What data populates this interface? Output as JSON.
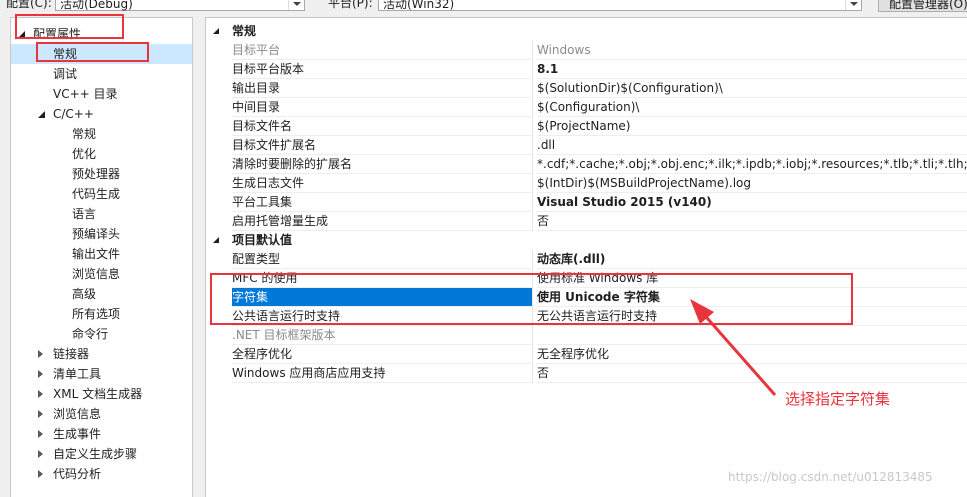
{
  "top_bar": {
    "config_label": "配置(C):",
    "config_value": "活动(Debug)",
    "platform_label": "平台(P):",
    "platform_value": "活动(Win32)",
    "config_manager_button": "配置管理器(O)..."
  },
  "tree": {
    "items": [
      {
        "label": "配置属性",
        "state": "expanded"
      },
      {
        "label": "常规",
        "state": "selected"
      },
      {
        "label": "调试"
      },
      {
        "label": "VC++ 目录"
      },
      {
        "label": "C/C++",
        "state": "expanded"
      },
      {
        "label": "常规"
      },
      {
        "label": "优化"
      },
      {
        "label": "预处理器"
      },
      {
        "label": "代码生成"
      },
      {
        "label": "语言"
      },
      {
        "label": "预编译头"
      },
      {
        "label": "输出文件"
      },
      {
        "label": "浏览信息"
      },
      {
        "label": "高级"
      },
      {
        "label": "所有选项"
      },
      {
        "label": "命令行"
      },
      {
        "label": "链接器",
        "state": "collapsed"
      },
      {
        "label": "清单工具",
        "state": "collapsed"
      },
      {
        "label": "XML 文档生成器",
        "state": "collapsed"
      },
      {
        "label": "浏览信息",
        "state": "collapsed"
      },
      {
        "label": "生成事件",
        "state": "collapsed"
      },
      {
        "label": "自定义生成步骤",
        "state": "collapsed"
      },
      {
        "label": "代码分析",
        "state": "collapsed"
      }
    ]
  },
  "grid": {
    "categories": [
      {
        "title": "常规",
        "rows": [
          {
            "name": "目标平台",
            "value": "Windows",
            "disabled": true
          },
          {
            "name": "目标平台版本",
            "value": "8.1",
            "bold": true
          },
          {
            "name": "输出目录",
            "value": "$(SolutionDir)$(Configuration)\\"
          },
          {
            "name": "中间目录",
            "value": "$(Configuration)\\"
          },
          {
            "name": "目标文件名",
            "value": "$(ProjectName)"
          },
          {
            "name": "目标文件扩展名",
            "value": ".dll"
          },
          {
            "name": "清除时要删除的扩展名",
            "value": "*.cdf;*.cache;*.obj;*.obj.enc;*.ilk;*.ipdb;*.iobj;*.resources;*.tlb;*.tli;*.tlh;*.tmp;*.rsp;*.pgc;*.pgd;*.meta"
          },
          {
            "name": "生成日志文件",
            "value": "$(IntDir)$(MSBuildProjectName).log"
          },
          {
            "name": "平台工具集",
            "value": "Visual Studio 2015 (v140)",
            "bold": true
          },
          {
            "name": "启用托管增量生成",
            "value": "否"
          }
        ]
      },
      {
        "title": "项目默认值",
        "rows": [
          {
            "name": "配置类型",
            "value": "动态库(.dll)",
            "bold": true
          },
          {
            "name": "MFC 的使用",
            "value": "使用标准 Windows 库"
          },
          {
            "name": "字符集",
            "value": "使用 Unicode 字符集",
            "selected": true
          },
          {
            "name": "公共语言运行时支持",
            "value": "无公共语言运行时支持"
          },
          {
            "name": ".NET 目标框架版本",
            "value": "",
            "disabled": true
          },
          {
            "name": "全程序优化",
            "value": "无全程序优化"
          },
          {
            "name": "Windows 应用商店应用支持",
            "value": "否"
          }
        ]
      }
    ]
  },
  "annotation": {
    "text": "选择指定字符集",
    "color": "#e8343c"
  },
  "watermark": "https://blog.csdn.net/u012813485",
  "colors": {
    "selection_blue": "#0078d7",
    "tree_selection": "#cce8ff"
  }
}
